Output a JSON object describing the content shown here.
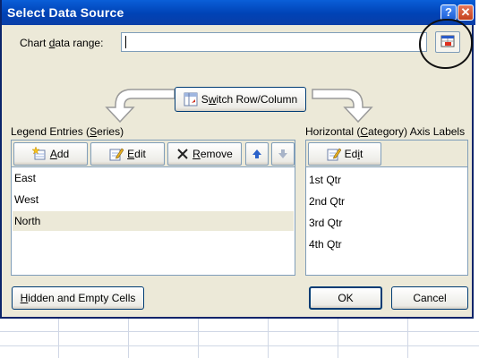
{
  "dialog": {
    "title": "Select Data Source",
    "help_icon": "question-mark-icon",
    "close_icon": "close-x-icon"
  },
  "range": {
    "label_pre": "Chart ",
    "label_u": "d",
    "label_post": "ata range:",
    "value": ""
  },
  "switch": {
    "label_pre": "S",
    "label_u": "w",
    "label_post": "itch Row/Column"
  },
  "legend": {
    "heading_pre": "Legend Entries (",
    "heading_u": "S",
    "heading_post": "eries)",
    "add_u": "A",
    "add_post": "dd",
    "edit_u": "E",
    "edit_post": "dit",
    "remove_u": "R",
    "remove_post": "emove",
    "items": [
      "East",
      "West",
      "North"
    ],
    "selected_index": 2
  },
  "axis": {
    "heading_pre": "Horizontal (",
    "heading_u": "C",
    "heading_post": "ategory) Axis Labels",
    "edit_pre": "Ed",
    "edit_u": "i",
    "edit_post": "t",
    "items": [
      "1st Qtr",
      "2nd Qtr",
      "3rd Qtr",
      "4th Qtr"
    ]
  },
  "footer": {
    "hidden_u": "H",
    "hidden_post": "idden and Empty Cells",
    "ok_label": "OK",
    "cancel_label": "Cancel"
  },
  "colors": {
    "title_bar": "#0a4fc8",
    "dialog_bg": "#ece9d8",
    "border_blue": "#7f9db9"
  }
}
